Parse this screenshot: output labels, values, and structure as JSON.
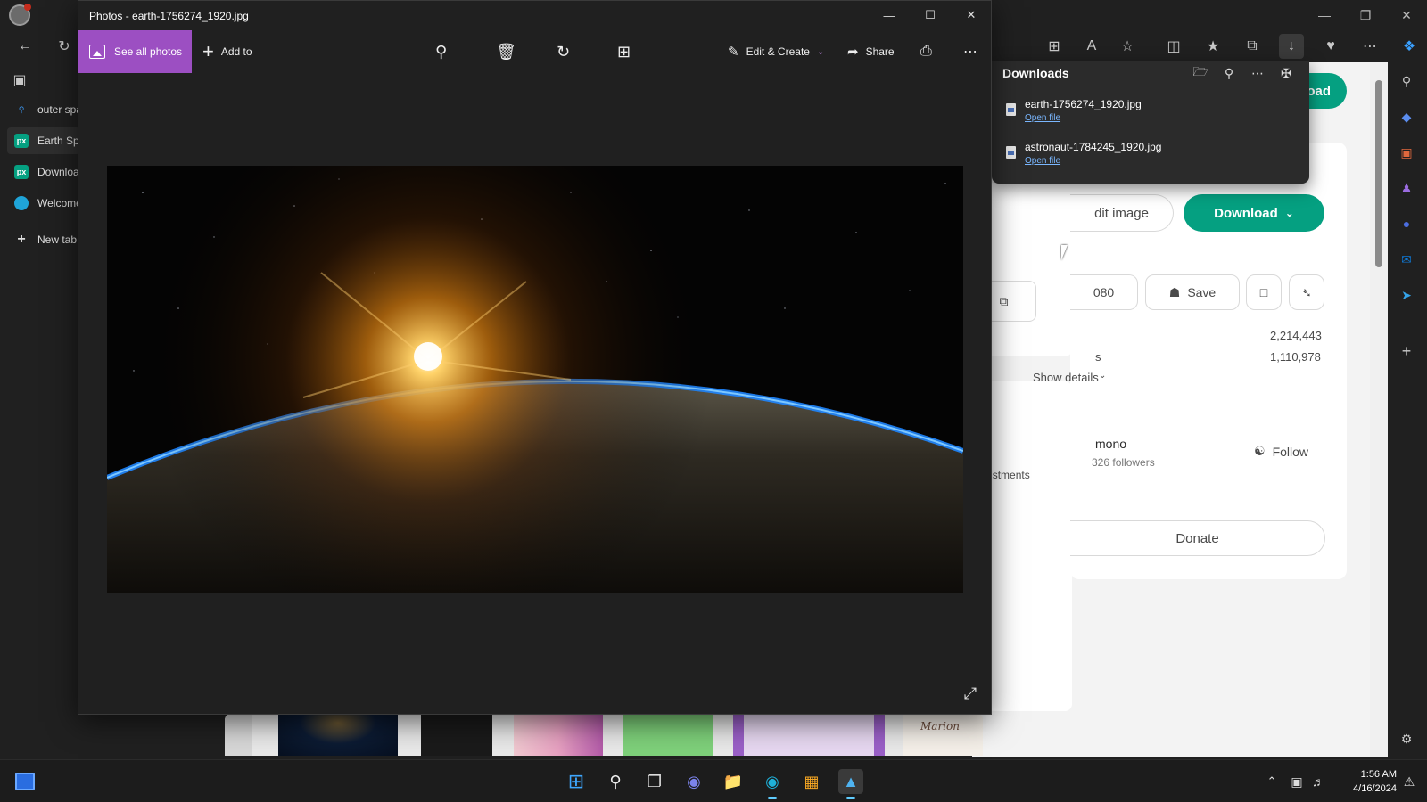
{
  "photos_window": {
    "title": "Photos - earth-1756274_1920.jpg",
    "toolbar": {
      "see_all": "See all photos",
      "add_to": "Add to",
      "edit_create": "Edit & Create",
      "share": "Share"
    },
    "image_name": "earth-1756274_1920.jpg",
    "accent": "#9c4fc2"
  },
  "browser": {
    "tabs": [
      {
        "label": "outer spa",
        "icon": "search-icon"
      },
      {
        "label": "Earth Sp",
        "icon": "pexels-icon"
      },
      {
        "label": "Downloa",
        "icon": "pexels-icon"
      },
      {
        "label": "Welcome",
        "icon": "edge-icon"
      },
      {
        "label": "New tab",
        "icon": "plus-icon"
      }
    ],
    "page": {
      "download_partial": "oad",
      "edit_image": "dit image",
      "download_btn": "Download",
      "size_partial": "080",
      "save": "Save",
      "stat_views": "2,214,443",
      "stat_downloads": "1,110,978",
      "stat_s": "s",
      "show_details": "Show details",
      "author": "mono",
      "followers": "326 followers",
      "follow": "Follow",
      "adjustments": "adjustments",
      "donate": "Donate",
      "thumb_text_1": "Marion",
      "brand_green": "#05a081"
    }
  },
  "downloads": {
    "title": "Downloads",
    "items": [
      {
        "name": "earth-1756274_1920.jpg",
        "action": "Open file"
      },
      {
        "name": "astronaut-1784245_1920.jpg",
        "action": "Open file"
      }
    ]
  },
  "taskbar": {
    "time": "1:56 AM",
    "date": "4/16/2024"
  }
}
